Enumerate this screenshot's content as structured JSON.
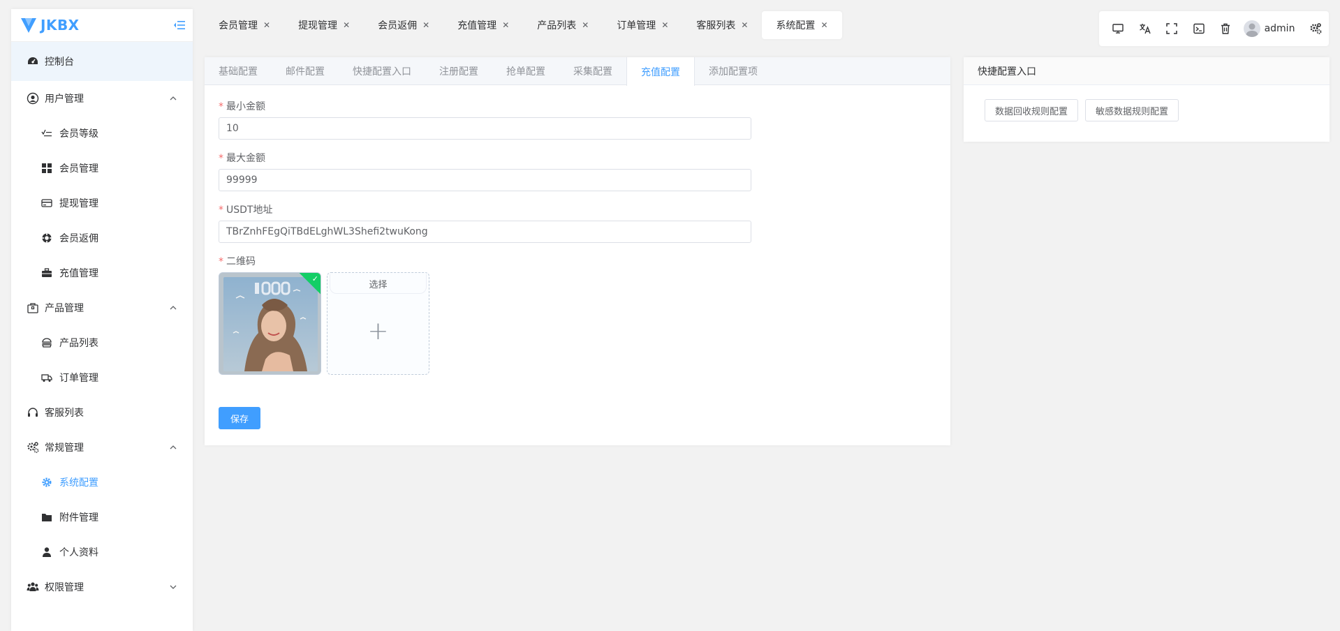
{
  "app": {
    "brand": "JKBX",
    "brand_color": "#409eff"
  },
  "sidebar": {
    "items": [
      {
        "label": "控制台",
        "icon": "dashboard-icon"
      },
      {
        "label": "用户管理",
        "icon": "user-circle-icon"
      },
      {
        "label": "会员等级",
        "icon": "list-check-icon"
      },
      {
        "label": "会员管理",
        "icon": "grid-icon"
      },
      {
        "label": "提现管理",
        "icon": "card-icon"
      },
      {
        "label": "会员返佣",
        "icon": "life-ring-icon"
      },
      {
        "label": "充值管理",
        "icon": "briefcase-icon"
      },
      {
        "label": "产品管理",
        "icon": "package-icon"
      },
      {
        "label": "产品列表",
        "icon": "burger-icon"
      },
      {
        "label": "订单管理",
        "icon": "truck-icon"
      },
      {
        "label": "客服列表",
        "icon": "headset-icon"
      },
      {
        "label": "常规管理",
        "icon": "cogs-icon"
      },
      {
        "label": "系统配置",
        "icon": "gear-icon"
      },
      {
        "label": "附件管理",
        "icon": "folder-icon"
      },
      {
        "label": "个人资料",
        "icon": "person-icon"
      },
      {
        "label": "权限管理",
        "icon": "users-icon"
      }
    ]
  },
  "tabs": [
    {
      "label": "会员管理"
    },
    {
      "label": "提现管理"
    },
    {
      "label": "会员返佣"
    },
    {
      "label": "充值管理"
    },
    {
      "label": "产品列表"
    },
    {
      "label": "订单管理"
    },
    {
      "label": "客服列表"
    },
    {
      "label": "系统配置"
    }
  ],
  "toolbar": {
    "username": "admin"
  },
  "config": {
    "subtabs": [
      "基础配置",
      "邮件配置",
      "快捷配置入口",
      "注册配置",
      "抢单配置",
      "采集配置",
      "充值配置",
      "添加配置项"
    ],
    "active_subtab": "充值配置",
    "fields": {
      "min_amount": {
        "label": "最小金额",
        "value": "10"
      },
      "max_amount": {
        "label": "最大金额",
        "value": "99999"
      },
      "usdt_address": {
        "label": "USDT地址",
        "value": "TBrZnhFEgQiTBdELghWL3Shefi2twuKong"
      },
      "qrcode": {
        "label": "二维码",
        "select_label": "选择"
      }
    },
    "save_label": "保存"
  },
  "quick": {
    "title": "快捷配置入口",
    "buttons": [
      "数据回收规则配置",
      "敏感数据规则配置"
    ]
  }
}
